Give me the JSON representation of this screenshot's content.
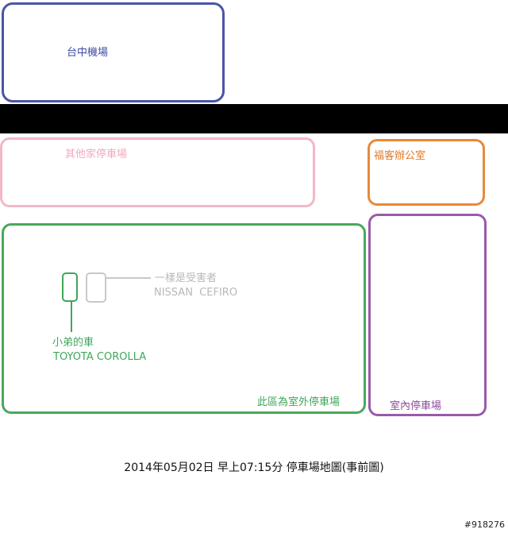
{
  "colors": {
    "airport": "#4a55a8",
    "other_lot": "#f2b8c6",
    "service": "#e8893a",
    "outdoor": "#4aa85a",
    "indoor": "#9a5aa8",
    "neutral_car": "#c8c8c8"
  },
  "zones": {
    "airport": "台中機場",
    "other_lot": "其他家停車場",
    "service_office": "福客辦公室",
    "outdoor_lot": "此區為室外停車場",
    "indoor_lot": "室內停車場"
  },
  "cars": {
    "brother": {
      "label": "小弟的車",
      "model": "TOYOTA COROLLA"
    },
    "other": {
      "label": "一樣是受害者",
      "model": "NISSAN  CEFIRO"
    }
  },
  "caption": "2014年05月02日 早上07:15分 停車場地圖(事前圖)",
  "watermark": "#918276"
}
